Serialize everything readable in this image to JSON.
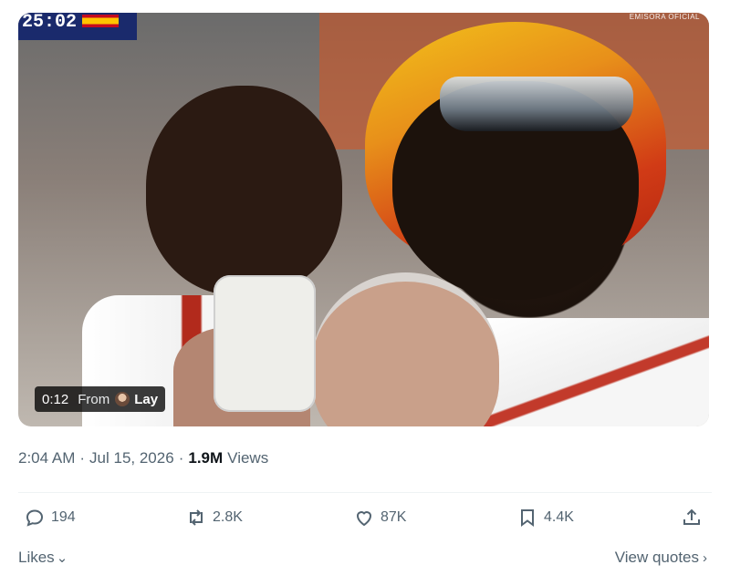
{
  "media": {
    "scoreboard_clock": "25:02",
    "broadcaster_tag": "EMISORA OFICIAL",
    "video_time": "0:12",
    "from_label": "From",
    "source_user": "Lay"
  },
  "tweet": {
    "time": "2:04 AM",
    "separator": "·",
    "date": "Jul 15, 2026",
    "views_count": "1.9M",
    "views_label": "Views"
  },
  "actions": {
    "reply_count": "194",
    "repost_count": "2.8K",
    "like_count": "87K",
    "bookmark_count": "4.4K"
  },
  "footer": {
    "likes_label": "Likes",
    "quotes_label": "View quotes",
    "likes_chevron": "⌄",
    "quotes_chevron": "›"
  },
  "icons": [
    "reply-icon",
    "repost-icon",
    "like-icon",
    "bookmark-icon",
    "share-icon",
    "chevron-down-icon",
    "chevron-right-icon"
  ]
}
